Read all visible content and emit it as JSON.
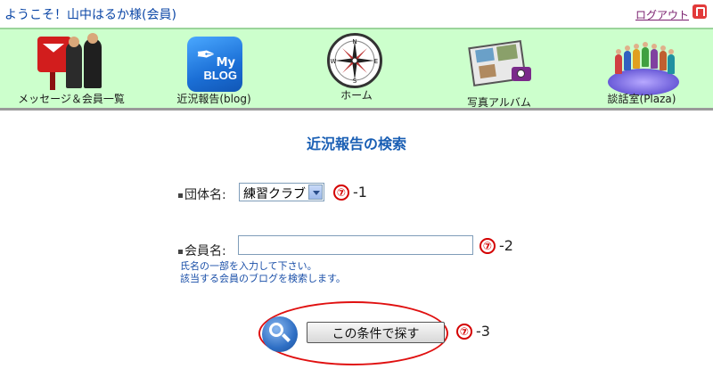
{
  "header": {
    "welcome": "ようこそ！山中はるか様(会員)",
    "logout_label": "ログアウト"
  },
  "nav": {
    "items": [
      {
        "label": "メッセージ＆会員一覧",
        "icon": "message-members-icon"
      },
      {
        "label": "近況報告(blog)",
        "icon": "my-blog-icon"
      },
      {
        "label": "ホーム",
        "icon": "compass-home-icon"
      },
      {
        "label": "写真アルバム",
        "icon": "photo-album-icon"
      },
      {
        "label": "談話室(Plaza)",
        "icon": "plaza-people-icon"
      }
    ],
    "blog_icon_text": {
      "my": "My",
      "blog": "BLOG"
    },
    "compass_letters": {
      "n": "N",
      "s": "S",
      "e": "E",
      "w": "W"
    }
  },
  "main": {
    "title": "近況報告の検索",
    "group_field": {
      "label": "団体名:",
      "selected": "練習クラブ",
      "badge": "⑦",
      "badge_suffix": "-1"
    },
    "member_field": {
      "label": "会員名:",
      "value": "",
      "badge": "⑦",
      "badge_suffix": "-2",
      "hint_line1": "氏名の一部を入力して下さい。",
      "hint_line2": "該当する会員のブログを検索します。"
    },
    "search": {
      "button_label": "この条件で探す",
      "badge": "⑦",
      "badge_suffix": "-3"
    }
  },
  "colors": {
    "nav_background": "#ccffcc",
    "accent_blue": "#1a5fb4",
    "annotation_red": "#e01010"
  }
}
